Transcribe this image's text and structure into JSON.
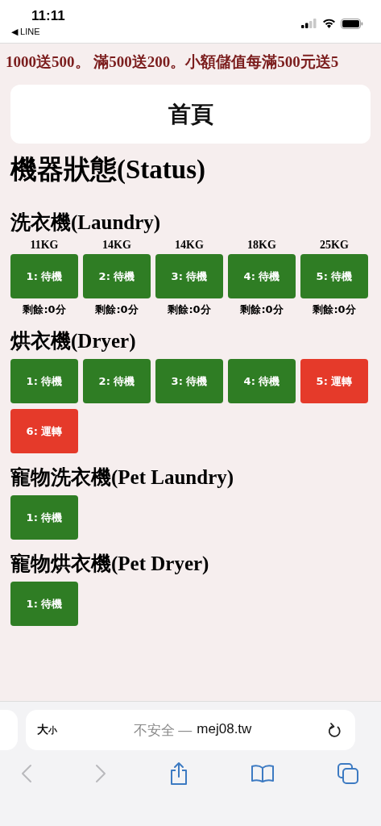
{
  "status_bar": {
    "time": "11:11",
    "back": "◀ LINE"
  },
  "marquee": "1000送500。 滿500送200。小額儲值每滿500元送5",
  "home_button": "首頁",
  "title": "機器狀態(Status)",
  "sections": [
    {
      "title": "洗衣機(Laundry)",
      "machines": [
        {
          "capacity": "11KG",
          "label": "1: 待機",
          "running": false,
          "remaining": "剩餘:0分"
        },
        {
          "capacity": "14KG",
          "label": "2: 待機",
          "running": false,
          "remaining": "剩餘:0分"
        },
        {
          "capacity": "14KG",
          "label": "3: 待機",
          "running": false,
          "remaining": "剩餘:0分"
        },
        {
          "capacity": "18KG",
          "label": "4: 待機",
          "running": false,
          "remaining": "剩餘:0分"
        },
        {
          "capacity": "25KG",
          "label": "5: 待機",
          "running": false,
          "remaining": "剩餘:0分"
        }
      ]
    },
    {
      "title": "烘衣機(Dryer)",
      "machines": [
        {
          "label": "1: 待機",
          "running": false
        },
        {
          "label": "2: 待機",
          "running": false
        },
        {
          "label": "3: 待機",
          "running": false
        },
        {
          "label": "4: 待機",
          "running": false
        },
        {
          "label": "5: 運轉",
          "running": true
        },
        {
          "label": "6: 運轉",
          "running": true
        }
      ]
    },
    {
      "title": "寵物洗衣機(Pet Laundry)",
      "machines": [
        {
          "label": "1: 待機",
          "running": false
        }
      ]
    },
    {
      "title": "寵物烘衣機(Pet Dryer)",
      "machines": [
        {
          "label": "1: 待機",
          "running": false
        }
      ]
    }
  ],
  "browser": {
    "text_size": [
      "大",
      "小"
    ],
    "security": "不安全 —",
    "domain": "mej08.tw"
  }
}
